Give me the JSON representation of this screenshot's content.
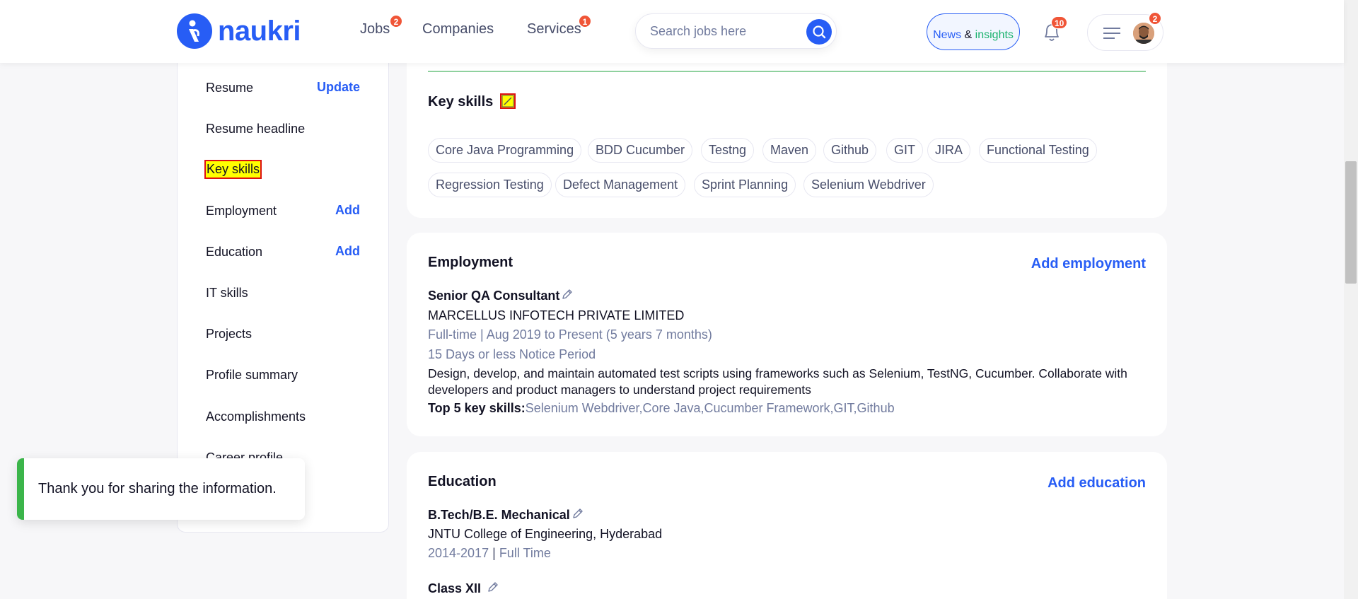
{
  "header": {
    "logo_text": "naukri",
    "nav": [
      {
        "label": "Jobs",
        "badge": "2"
      },
      {
        "label": "Companies",
        "badge": ""
      },
      {
        "label": "Services",
        "badge": "1"
      }
    ],
    "search_placeholder": "Search jobs here",
    "news_part1": "News",
    "news_part2": "&",
    "news_part3": "insights",
    "notifications_badge": "10",
    "menu_badge": "2"
  },
  "sidebar": {
    "items": [
      {
        "label": "Resume",
        "action": "Update"
      },
      {
        "label": "Resume headline",
        "action": ""
      },
      {
        "label": "Key skills",
        "action": ""
      },
      {
        "label": "Employment",
        "action": "Add"
      },
      {
        "label": "Education",
        "action": "Add"
      },
      {
        "label": "IT skills",
        "action": ""
      },
      {
        "label": "Projects",
        "action": ""
      },
      {
        "label": "Profile summary",
        "action": ""
      },
      {
        "label": "Accomplishments",
        "action": ""
      },
      {
        "label": "Career profile",
        "action": ""
      }
    ]
  },
  "toast": {
    "message": "Thank you for sharing the information."
  },
  "key_skills": {
    "title": "Key skills",
    "skills": [
      "Core Java Programming",
      "BDD Cucumber",
      "Testng",
      "Maven",
      "Github",
      "GIT",
      "JIRA",
      "Functional Testing",
      "Regression Testing",
      "Defect Management",
      "Sprint Planning",
      "Selenium Webdriver"
    ]
  },
  "employment": {
    "title": "Employment",
    "action": "Add employment",
    "role": "Senior QA Consultant",
    "company": "MARCELLUS INFOTECH PRIVATE LIMITED",
    "duration": "Full-time | Aug 2019 to Present (5 years 7 months)",
    "notice": "15 Days or less Notice Period",
    "description": "Design, develop, and maintain automated test scripts using frameworks such as Selenium, TestNG, Cucumber. Collaborate with developers and product managers to understand project requirements",
    "top_skills_label": "Top 5 key skills:",
    "top_skills": "Selenium Webdriver,Core Java,Cucumber Framework,GIT,Github"
  },
  "education": {
    "title": "Education",
    "action": "Add education",
    "degree": "B.Tech/B.E. Mechanical",
    "college": "JNTU College of Engineering, Hyderabad",
    "years": "2014-2017",
    "mode": "Full Time",
    "next_degree": "Class XII"
  },
  "colors": {
    "brand": "#275df5",
    "badge": "#f05537",
    "toast_accent": "#3bb54a",
    "highlight": "#ffff00"
  }
}
